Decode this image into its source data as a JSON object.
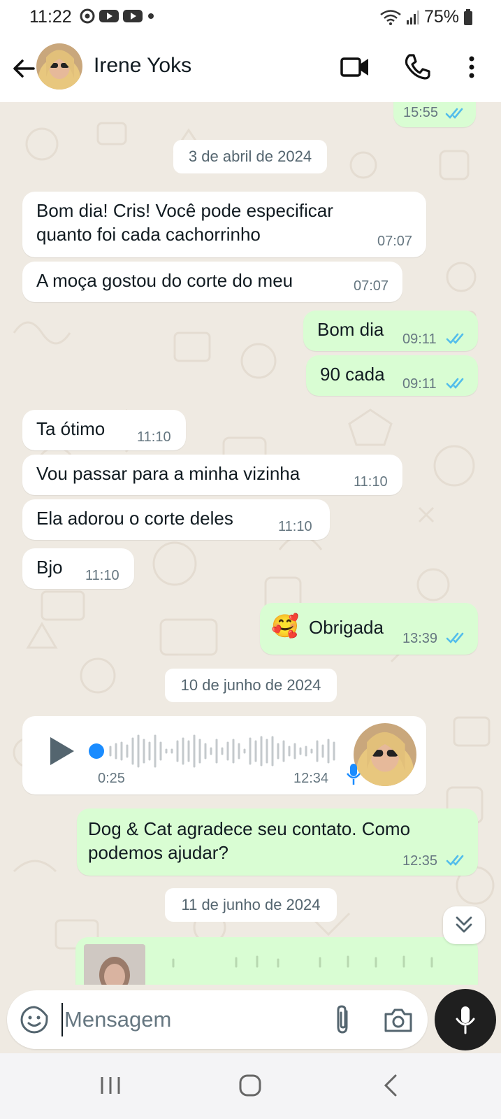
{
  "status_bar": {
    "time": "11:22",
    "battery": "75%"
  },
  "header": {
    "contact_name": "Irene Yoks"
  },
  "messages": [
    {
      "time": "15:55"
    },
    {
      "date": "3 de abril de 2024"
    },
    {
      "text_line1": "Bom dia! Cris! Você pode especificar",
      "text_line2": "quanto foi cada cachorrinho",
      "time": "07:07"
    },
    {
      "text": "A moça gostou do corte do meu",
      "time": "07:07"
    },
    {
      "text": "Bom dia",
      "time": "09:11"
    },
    {
      "text": "90 cada",
      "time": "09:11"
    },
    {
      "text": "Ta ótimo",
      "time": "11:10"
    },
    {
      "text": "Vou passar para a minha vizinha",
      "time": "11:10"
    },
    {
      "text": "Ela adorou o corte deles",
      "time": "11:10"
    },
    {
      "text": "Bjo",
      "time": "11:10"
    },
    {
      "emoji": "🥰",
      "text": "Obrigada",
      "time": "13:39"
    },
    {
      "date": "10 de junho de 2024"
    },
    {
      "duration": "0:25",
      "time": "12:34"
    },
    {
      "text_line1": "Dog & Cat agradece seu contato. Como",
      "text_line2": "podemos ajudar?",
      "time": "12:35"
    },
    {
      "date": "11 de junho de 2024"
    }
  ],
  "composer": {
    "placeholder": "Mensagem"
  },
  "colors": {
    "incoming_bubble": "#ffffff",
    "outgoing_bubble": "#d9fdd3",
    "chat_background": "#efeae2",
    "read_ticks": "#53bdeb",
    "mic_button": "#1f1f1f"
  },
  "icons": [
    "back-arrow-icon",
    "video-call-icon",
    "phone-icon",
    "more-options-icon",
    "sticker-icon",
    "attach-icon",
    "camera-icon",
    "mic-icon",
    "play-icon",
    "double-check-icon",
    "scroll-down-icon"
  ]
}
